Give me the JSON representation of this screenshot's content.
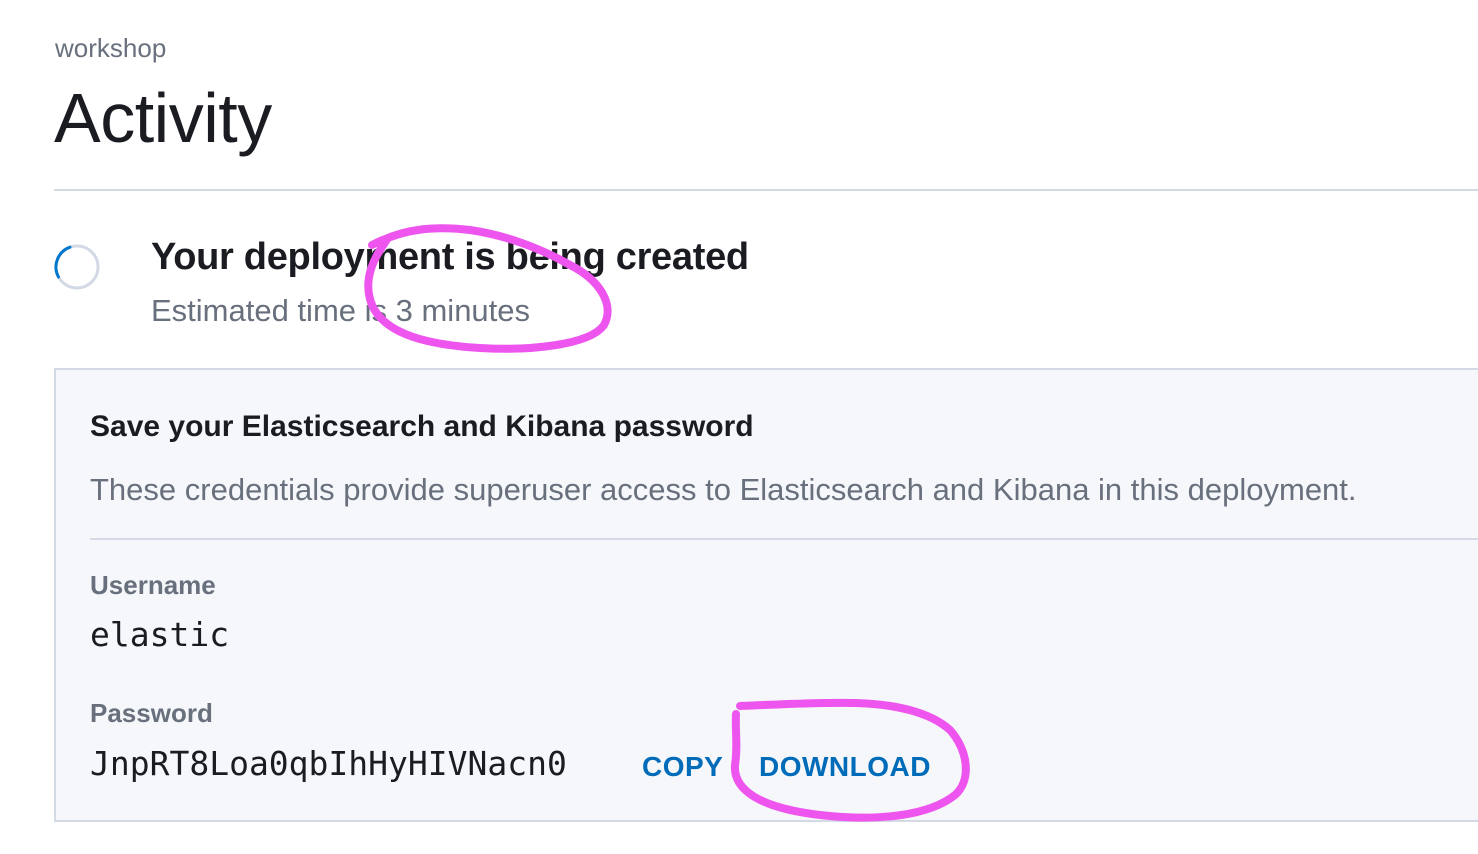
{
  "breadcrumb": "workshop",
  "page_title": "Activity",
  "status": {
    "title": "Your deployment is being created",
    "subtitle": "Estimated time is 3 minutes"
  },
  "credentials": {
    "title": "Save your Elasticsearch and Kibana password",
    "description": "These credentials provide superuser access to Elasticsearch and Kibana in this deployment.",
    "username_label": "Username",
    "username_value": "elastic",
    "password_label": "Password",
    "password_value": "JnpRT8Loa0qbIhHyHIVNacn0",
    "copy_label": "COPY",
    "download_label": "DOWNLOAD"
  },
  "colors": {
    "link": "#006bb8",
    "annotation": "#ee55ee",
    "panel_bg": "#f5f7fa"
  }
}
